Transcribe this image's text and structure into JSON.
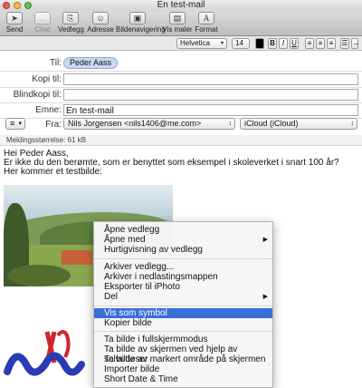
{
  "window": {
    "title": "En test-mail"
  },
  "toolbar": {
    "send": "Send",
    "chat": "Chat",
    "attach": "Vedlegg",
    "address": "Adresse",
    "photo_browser": "Bildenavigering",
    "templates": "Vis maler",
    "format": "Format"
  },
  "format_bar": {
    "font": "Helvetica",
    "size": "14",
    "bold": "B",
    "italic": "I",
    "underline": "U"
  },
  "headers": {
    "to_label": "Til:",
    "to_value": "Peder Aass",
    "cc_label": "Kopi til:",
    "cc_value": "",
    "bcc_label": "Blindkopi til:",
    "bcc_value": "",
    "subject_label": "Emne:",
    "subject_value": "En test-mail",
    "from_label": "Fra:",
    "from_value": "Nils Jorgensen <nils1406@me.com>",
    "account_value": "iCloud (iCloud)",
    "msg_size": "Meldingsstørrelse: 61 kB"
  },
  "body": {
    "line1": "Hei Peder Aass,",
    "line2": "Er ikke du den berømte, som er benyttet som eksempel i skoleverket i snart 100 år?",
    "line3": "Her kommer et testbilde:"
  },
  "menu": {
    "items": [
      {
        "label": "Åpne vedlegg",
        "sub": false
      },
      {
        "label": "Åpne med",
        "sub": true
      },
      {
        "label": "Hurtigvisning av vedlegg",
        "sub": false
      },
      {
        "label": "Arkiver vedlegg...",
        "sub": false
      },
      {
        "label": "Arkiver i nedlastingsmappen",
        "sub": false
      },
      {
        "label": "Eksporter til iPhoto",
        "sub": false
      },
      {
        "label": "Del",
        "sub": true
      },
      {
        "label": "Vis som symbol",
        "sub": false,
        "highlighted": true
      },
      {
        "label": "Kopier bilde",
        "sub": false
      },
      {
        "label": "Ta bilde i fullskjermmodus",
        "sub": false
      },
      {
        "label": "Ta bilde av skjermen ved hjelp av selvutløser",
        "sub": false
      },
      {
        "label": "Ta bilde av markert område på skjermen",
        "sub": false
      },
      {
        "label": "Importer bilde",
        "sub": false
      },
      {
        "label": "Short Date & Time",
        "sub": false
      }
    ]
  },
  "colors": {
    "highlight": "#3a6fd8"
  }
}
